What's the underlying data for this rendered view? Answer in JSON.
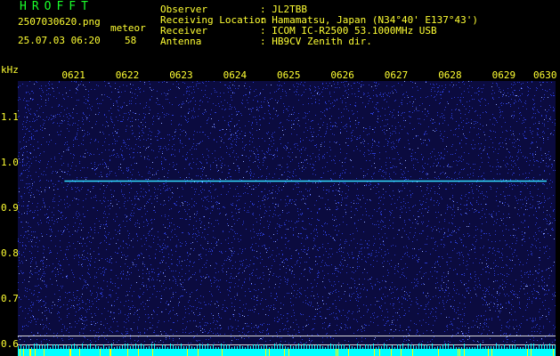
{
  "header": {
    "brand": "HROFFT",
    "filename": "2507030620.png",
    "meteor_label": "meteor",
    "datetime": "25.07.03 06:20",
    "meteor_count": "58",
    "info": [
      {
        "label": "Observer",
        "value": ": JL2TBB"
      },
      {
        "label": "Receiving Location",
        "value": ": Hamamatsu, Japan (N34°40' E137°43')"
      },
      {
        "label": "Receiver",
        "value": ": ICOM IC-R2500 53.1000MHz USB"
      },
      {
        "label": "Antenna",
        "value": ": HB9CV Zenith dir."
      }
    ]
  },
  "chart_data": {
    "type": "heatmap",
    "ylabel": "kHz",
    "y_ticks": [
      "1.1",
      "1.0",
      "0.9",
      "0.8",
      "0.7",
      "0.6"
    ],
    "y_tick_values": [
      1.1,
      1.0,
      0.9,
      0.8,
      0.7,
      0.6
    ],
    "x_ticks": [
      "0621",
      "0622",
      "0623",
      "0624",
      "0625",
      "0626",
      "0627",
      "0628",
      "0629",
      "0630"
    ],
    "ylim": [
      0.575,
      1.18
    ],
    "xlim": [
      "06:20",
      "06:30"
    ],
    "traces": [
      {
        "kind": "carrier",
        "y": 0.96,
        "x_start": "06:21",
        "x_end": "06:30"
      }
    ],
    "reference_lines": [
      0.62,
      0.6
    ],
    "colors": {
      "background": "#0b0b3f",
      "noise": "#2a3bd0",
      "carrier": "#33ddff",
      "reference": "#d8d8d8",
      "baseline": "#00ffff",
      "spike": "#ffff00"
    }
  }
}
